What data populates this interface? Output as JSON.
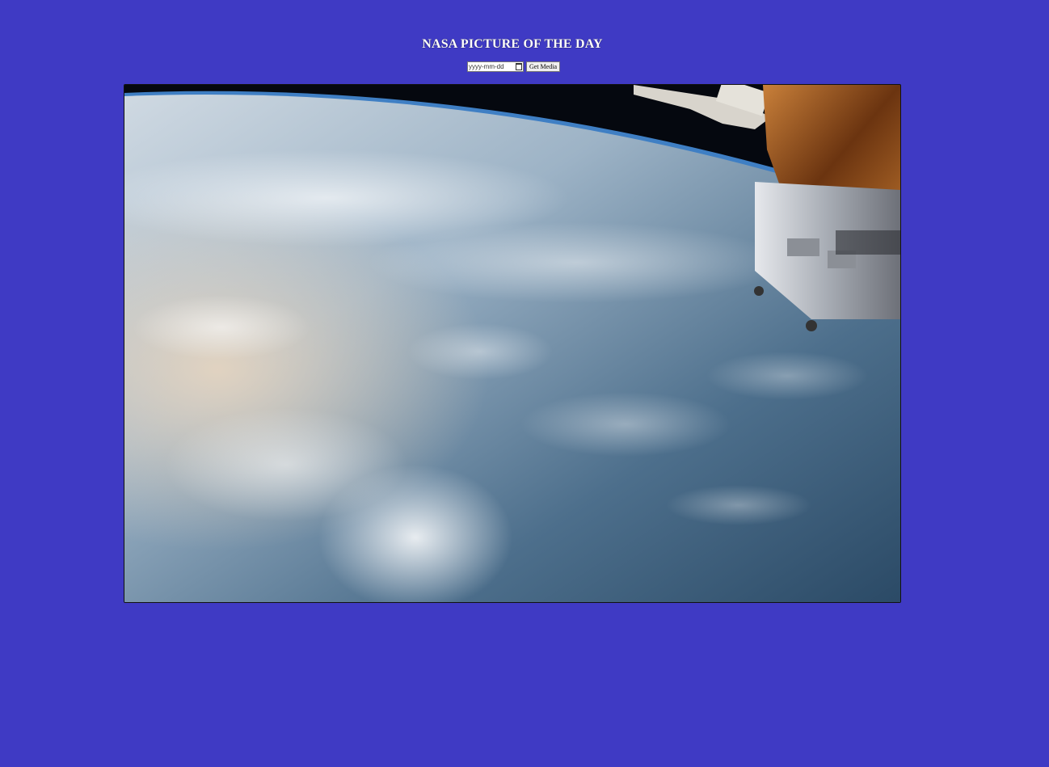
{
  "header": {
    "title": "NASA PICTURE OF THE DAY"
  },
  "controls": {
    "date_placeholder": "yyyy-mm-dd",
    "submit_label": "Get Media"
  },
  "media": {
    "image_alt": "Earth from orbit with spacecraft module"
  },
  "colors": {
    "background": "#3f3ac4",
    "title_text": "#ffffff"
  }
}
